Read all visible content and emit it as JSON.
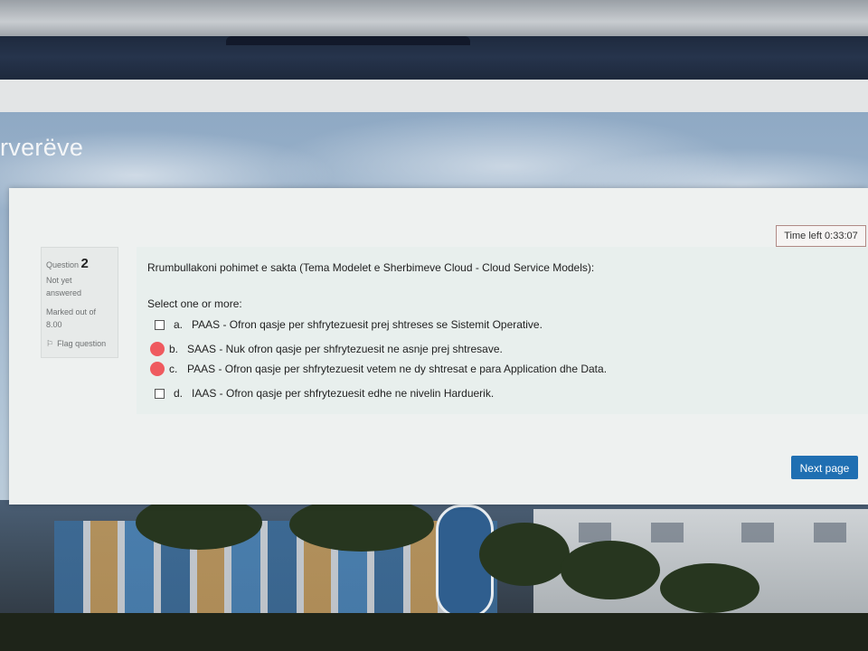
{
  "course": {
    "title_fragment": "rverëve"
  },
  "quiz": {
    "timer_text": "Time left 0:33:07",
    "question_info": {
      "label": "Question",
      "number": "2",
      "status_line1": "Not yet",
      "status_line2": "answered",
      "marked_line1": "Marked out of",
      "marked_line2": "8.00",
      "flag_label": "Flag question"
    },
    "question_text": "Rrumbullakoni pohimet e sakta (Tema Modelet e Sherbimeve Cloud - Cloud Service Models):",
    "prompt": "Select one or more:",
    "options": [
      {
        "letter": "a.",
        "text": "PAAS - Ofron qasje per shfrytezuesit prej shtreses se Sistemit Operative.",
        "marked": false
      },
      {
        "letter": "b.",
        "text": "SAAS - Nuk ofron qasje per shfrytezuesit ne asnje prej shtresave.",
        "marked": true
      },
      {
        "letter": "c.",
        "text": "PAAS - Ofron qasje per shfrytezuesit vetem ne dy shtresat e para Application dhe Data.",
        "marked": true
      },
      {
        "letter": "d.",
        "text": "IAAS - Ofron qasje per shfrytezuesit edhe ne nivelin Harduerik.",
        "marked": false
      }
    ],
    "next_label": "Next page"
  },
  "colors": {
    "accent": "#1f6fb2",
    "marker": "#ef5a5f"
  }
}
